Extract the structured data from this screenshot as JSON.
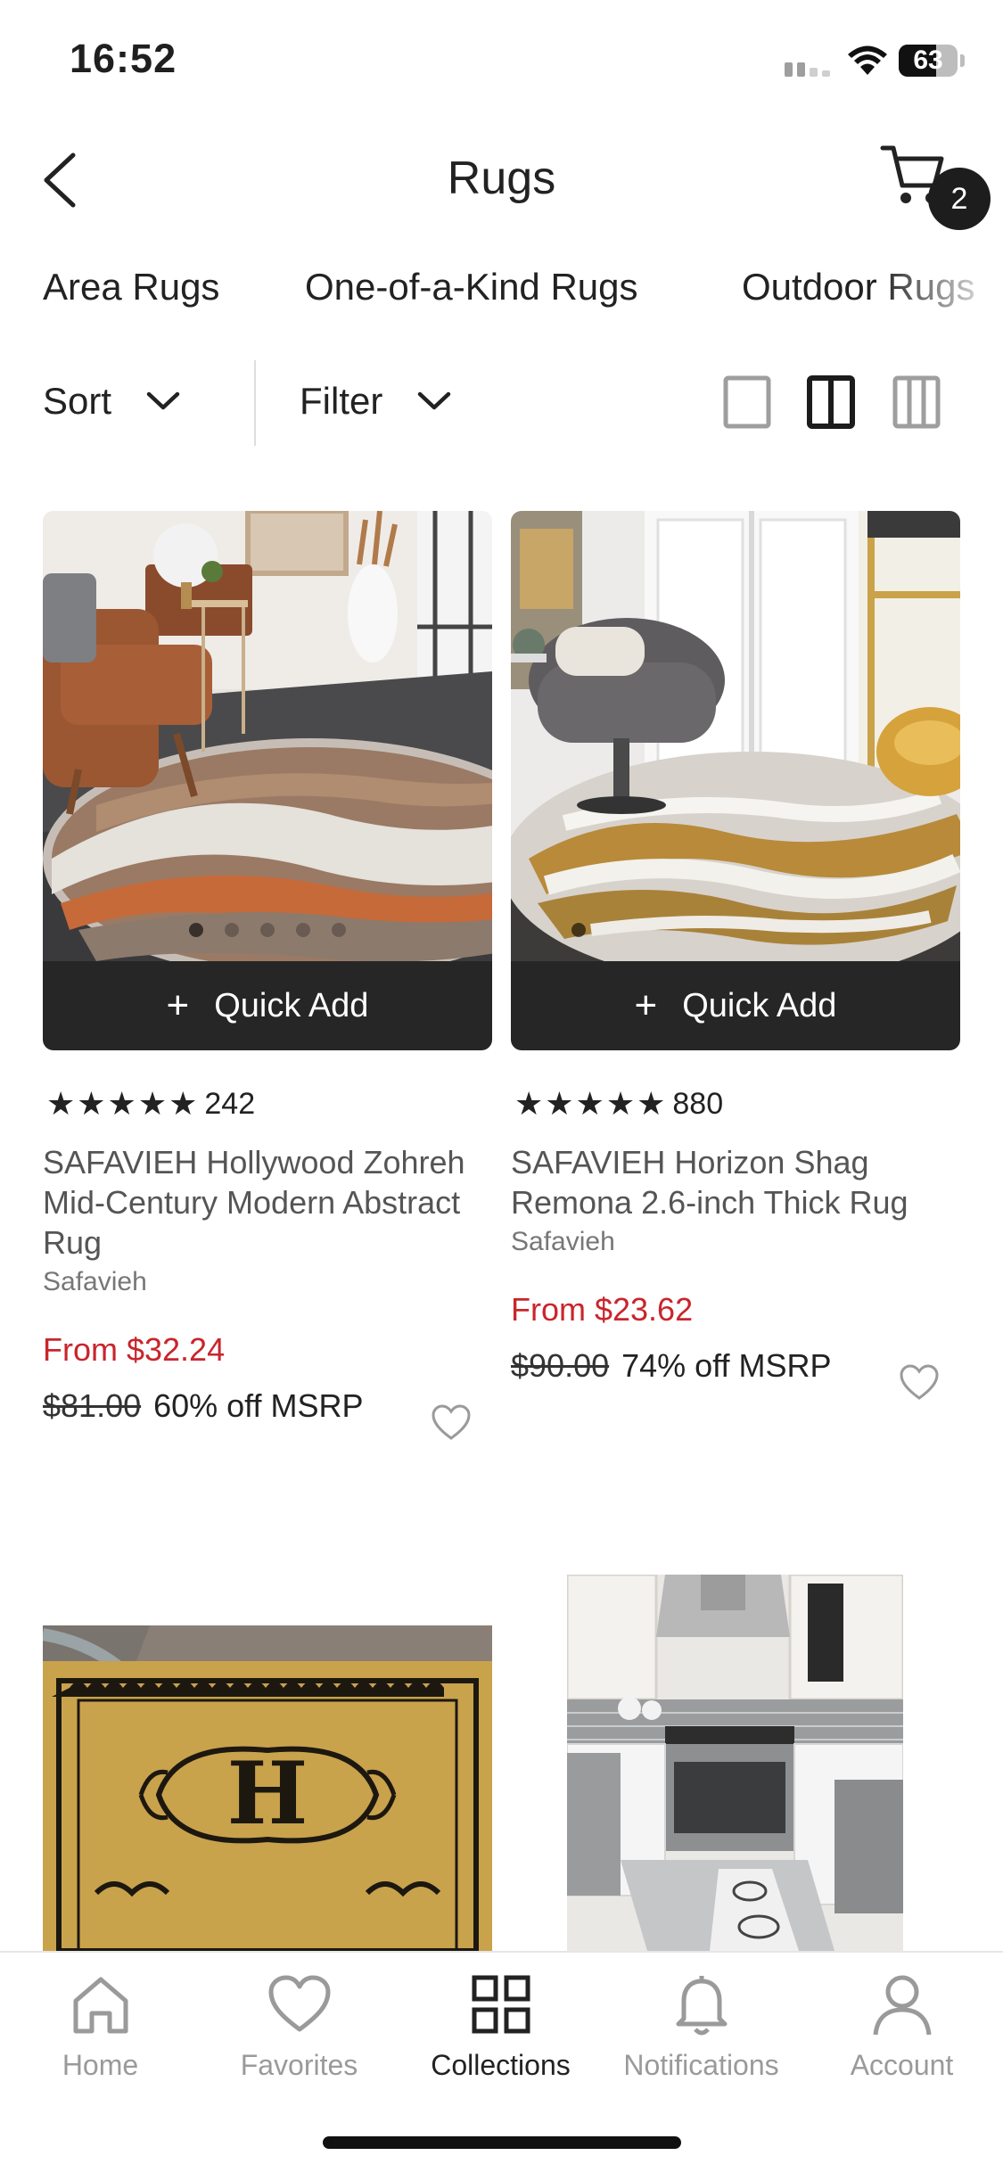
{
  "status_bar": {
    "time": "16:52",
    "battery": "63",
    "battery_level": 0.63
  },
  "header": {
    "title": "Rugs",
    "cart_count": "2"
  },
  "categories": [
    {
      "label": "Area Rugs"
    },
    {
      "label": "One-of-a-Kind Rugs"
    },
    {
      "label": "Outdoor Rugs"
    }
  ],
  "controls": {
    "sort_label": "Sort",
    "filter_label": "Filter",
    "view_options": [
      "single-column-view-icon",
      "two-column-view-icon",
      "three-column-view-icon"
    ],
    "active_view": "two-column-view-icon"
  },
  "products": [
    {
      "quick_add": "Quick Add",
      "rating_count": "242",
      "stars": 5,
      "name": "SAFAVIEH Hollywood Zohreh Mid-Century Modern Abstract Rug",
      "brand": "Safavieh",
      "price": "From $32.24",
      "msrp_old": "$81.00",
      "discount": "60% off MSRP",
      "image_dots": 5
    },
    {
      "quick_add": "Quick Add",
      "rating_count": "880",
      "stars": 5,
      "name": "SAFAVIEH Horizon Shag Remona 2.6-inch Thick Rug",
      "brand": "Safavieh",
      "price": "From $23.62",
      "msrp_old": "$90.00",
      "discount": "74% off MSRP",
      "image_dots": 1
    }
  ],
  "tab_bar": [
    {
      "label": "Home",
      "icon": "home-icon"
    },
    {
      "label": "Favorites",
      "icon": "heart-icon"
    },
    {
      "label": "Collections",
      "icon": "grid-icon",
      "active": true
    },
    {
      "label": "Notifications",
      "icon": "bell-icon"
    },
    {
      "label": "Account",
      "icon": "person-icon"
    }
  ],
  "colors": {
    "accent_price": "#c9252c",
    "dark": "#262626",
    "muted": "#9a9a9a"
  }
}
